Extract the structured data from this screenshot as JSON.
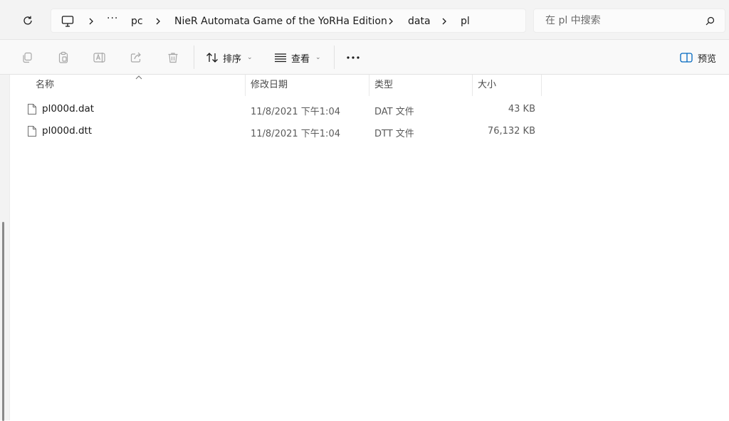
{
  "address_bar": {
    "breadcrumb": {
      "overflow": "···",
      "segments": [
        "pc",
        "NieR Automata Game of the YoRHa Edition",
        "data",
        "pl"
      ]
    },
    "search_placeholder": "在 pl 中搜索"
  },
  "command_bar": {
    "sort_label": "排序",
    "view_label": "查看",
    "more": "···",
    "preview_label": "预览"
  },
  "columns": {
    "name": "名称",
    "date": "修改日期",
    "type": "类型",
    "size": "大小"
  },
  "files": [
    {
      "name": "pl000d.dat",
      "date": "11/8/2021 下午1:04",
      "type": "DAT 文件",
      "size": "43 KB"
    },
    {
      "name": "pl000d.dtt",
      "date": "11/8/2021 下午1:04",
      "type": "DTT 文件",
      "size": "76,132 KB"
    }
  ],
  "colors": {
    "chrome_bg": "#f3f3f3",
    "command_bg": "#f9f9f9",
    "disabled_icon": "#a8a8a8",
    "text": "#1a1a1a",
    "secondary_text": "#5b5b5b",
    "accent": "#0067c0"
  },
  "icons": {
    "refresh": "refresh-icon",
    "computer": "computer-icon",
    "chevron": "chevron-right-icon",
    "search": "search-icon",
    "copy": "copy-icon",
    "paste": "paste-icon",
    "rename": "rename-icon",
    "share": "share-icon",
    "delete": "delete-icon",
    "sort": "sort-icon",
    "view": "view-icon",
    "preview": "preview-pane-icon",
    "file": "file-icon"
  }
}
